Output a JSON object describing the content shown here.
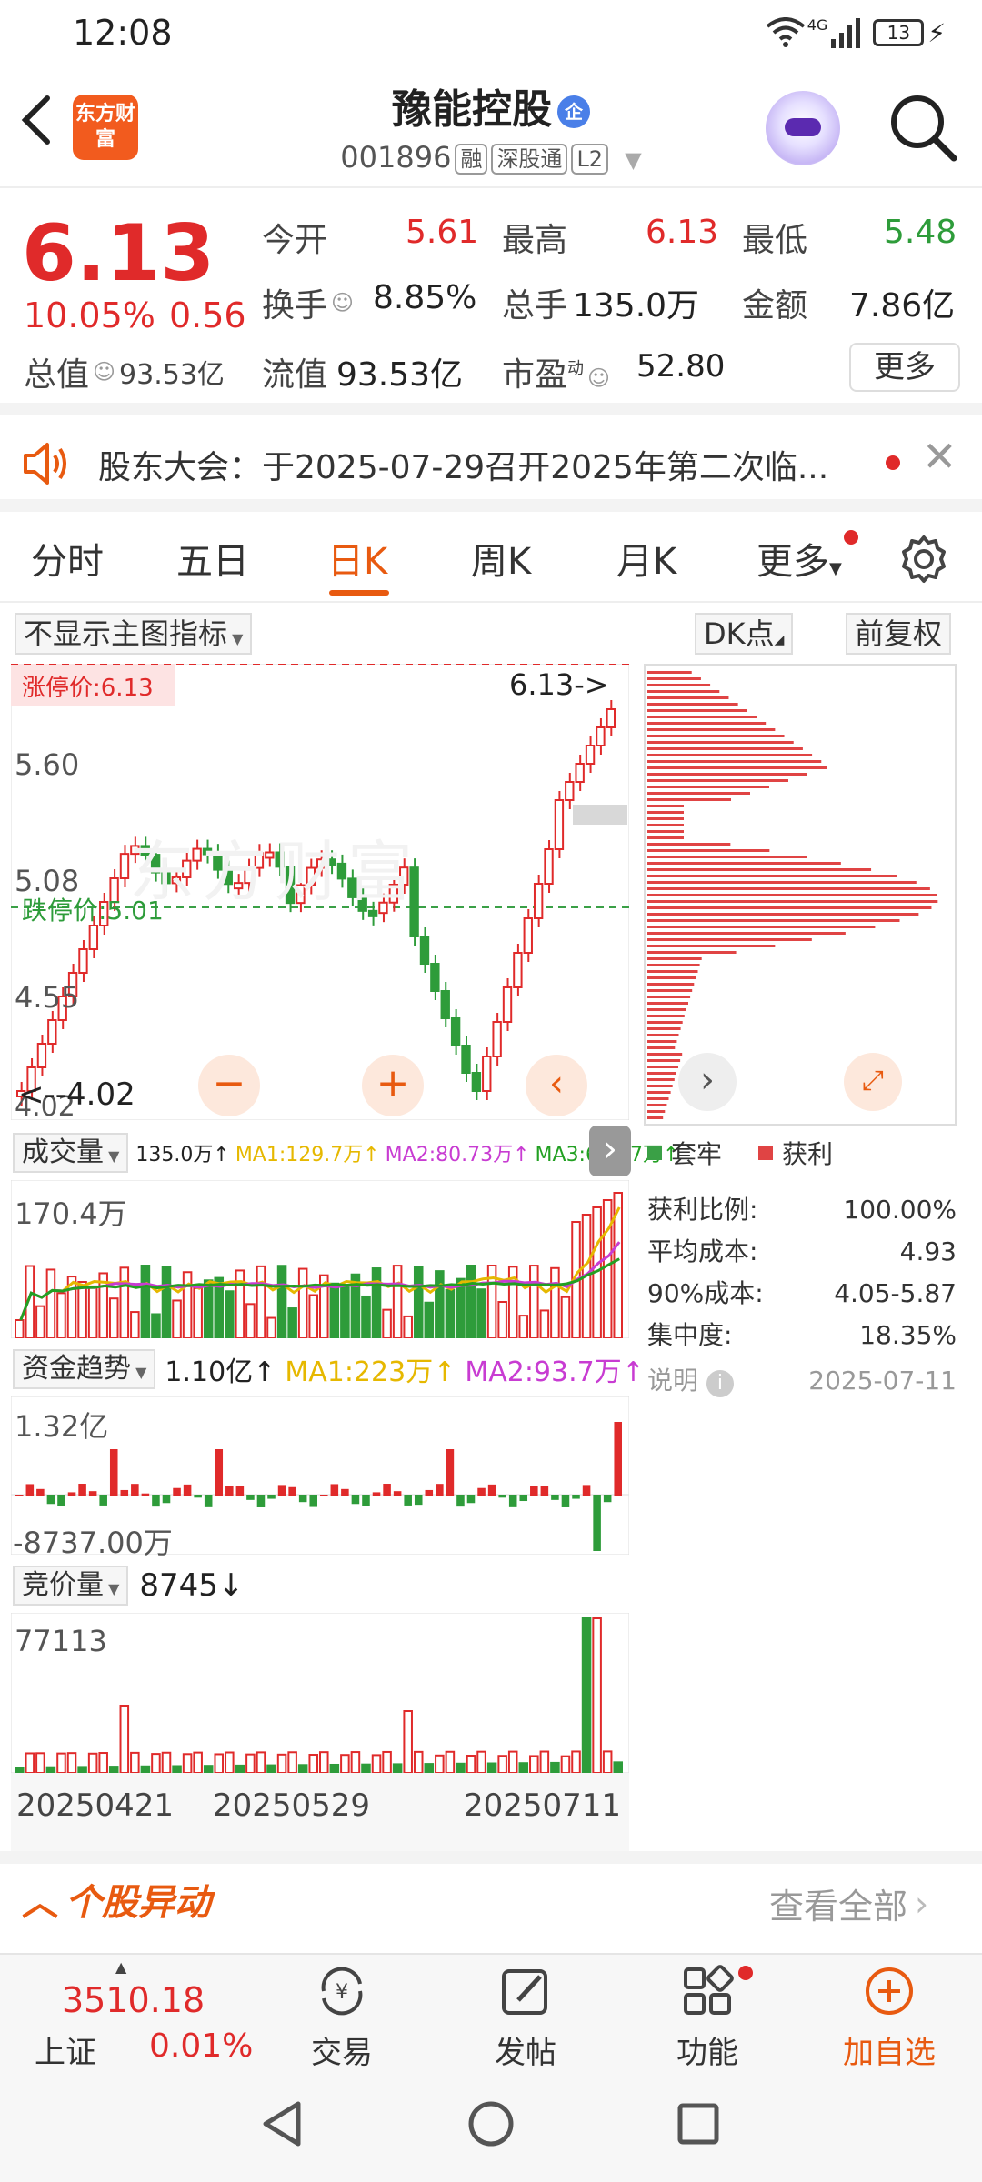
{
  "status": {
    "time": "12:08",
    "network": "4G",
    "battery": "13"
  },
  "header": {
    "logo_text": "东方财富",
    "stock_name": "豫能控股",
    "name_badge": "企",
    "stock_code": "001896",
    "tags": [
      "融",
      "深股通",
      "L2"
    ]
  },
  "quote": {
    "price": "6.13",
    "change_pct": "10.05%",
    "change_amt": "0.56",
    "open_label": "今开",
    "open": "5.61",
    "high_label": "最高",
    "high": "6.13",
    "low_label": "最低",
    "low": "5.48",
    "turnover_label": "换手",
    "turnover": "8.85%",
    "volume_label": "总手",
    "volume": "135.0万",
    "amount_label": "金额",
    "amount": "7.86亿",
    "total_value_label": "总值",
    "total_value": "93.53亿",
    "float_value_label": "流值",
    "float_value": "93.53亿",
    "pe_label": "市盈",
    "pe_sup": "动",
    "pe": "52.80",
    "more_button": "更多"
  },
  "notice": {
    "text": "股东大会：于2025-07-29召开2025年第二次临..."
  },
  "tabs": [
    "分时",
    "五日",
    "日K",
    "周K",
    "月K",
    "更多"
  ],
  "active_tab": "日K",
  "chart_controls": {
    "indicator_select": "不显示主图指标",
    "dk_button": "DK点",
    "adjust_button": "前复权"
  },
  "kline": {
    "limit_up_label": "涨停价:6.13",
    "limit_down_label": "跌停价:5.01",
    "y_ticks": [
      "5.60",
      "5.08",
      "4.55",
      "4.02"
    ],
    "max_marker": "6.13->",
    "min_marker": "<--4.02",
    "watermark": "东方财富"
  },
  "volume_panel": {
    "select": "成交量",
    "value": "135.0万↑",
    "ma1": "MA1:129.7万↑",
    "ma2": "MA2:80.73万↑",
    "ma3": "MA3:60.97万↑",
    "top_label": "170.4万"
  },
  "fund_panel": {
    "select": "资金趋势",
    "value": "1.10亿↑",
    "ma1": "MA1:223万↑",
    "ma2": "MA2:93.7万↑",
    "top_label": "1.32亿",
    "bottom_label": "-8737.00万"
  },
  "auction_panel": {
    "select": "竞价量",
    "value": "8745↓",
    "top_label": "77113",
    "dates": [
      "20250421",
      "20250529",
      "20250711"
    ]
  },
  "chip": {
    "legend_trapped": "套牢",
    "legend_profit": "获利",
    "profit_ratio_label": "获利比例:",
    "profit_ratio": "100.00%",
    "avg_cost_label": "平均成本:",
    "avg_cost": "4.93",
    "cost90_label": "90%成本:",
    "cost90": "4.05-5.87",
    "concentration_label": "集中度:",
    "concentration": "18.35%",
    "note_label": "说明",
    "date": "2025-07-11"
  },
  "movement": {
    "title": "个股异动",
    "view_all": "查看全部"
  },
  "bottom_nav": {
    "index_value": "3510.18",
    "index_name": "上证",
    "index_change": "0.01%",
    "items": [
      "交易",
      "发帖",
      "功能",
      "加自选"
    ]
  },
  "colors": {
    "up": "#e02a2a",
    "down": "#2e9c3a",
    "accent": "#e85a10",
    "ma1": "#e6b800",
    "ma2": "#c83cd2",
    "ma3": "#22a022"
  }
}
